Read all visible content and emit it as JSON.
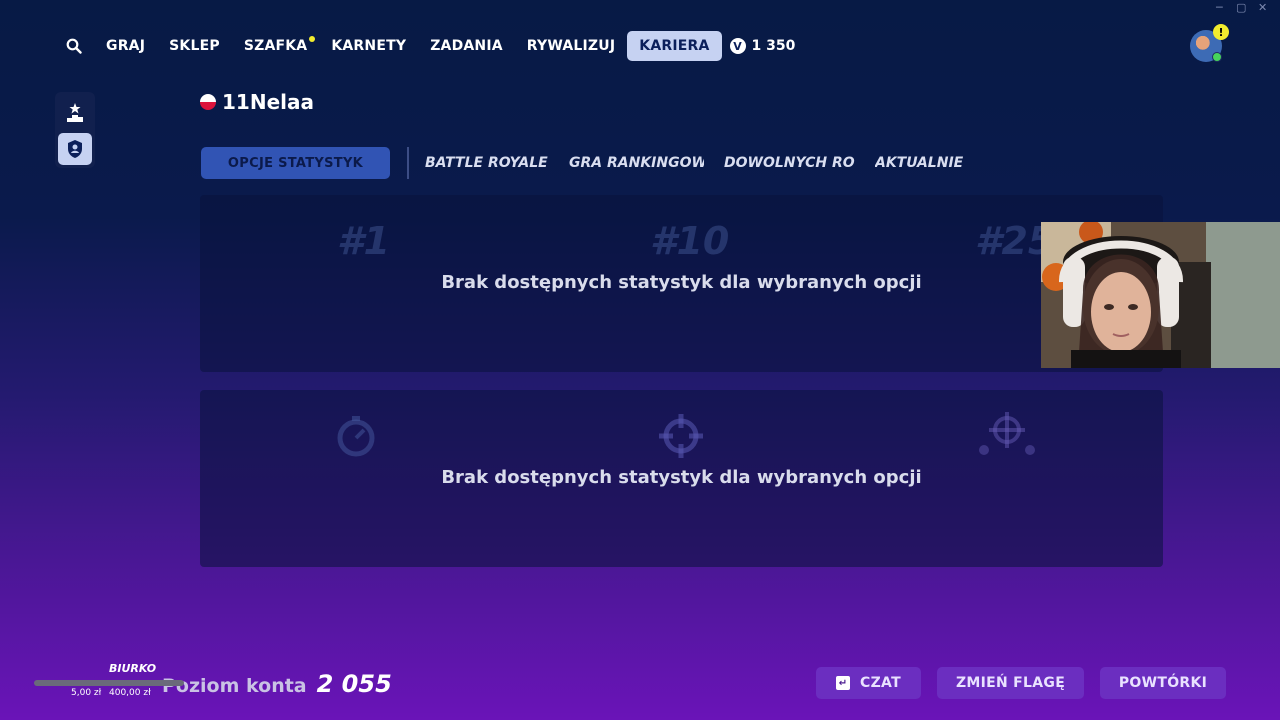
{
  "nav": {
    "items": [
      {
        "label": "GRAJ",
        "active": false,
        "notify": false
      },
      {
        "label": "SKLEP",
        "active": false,
        "notify": false
      },
      {
        "label": "SZAFKA",
        "active": false,
        "notify": true
      },
      {
        "label": "KARNETY",
        "active": false,
        "notify": false
      },
      {
        "label": "ZADANIA",
        "active": false,
        "notify": false
      },
      {
        "label": "RYWALIZUJ",
        "active": false,
        "notify": false
      },
      {
        "label": "KARIERA",
        "active": true,
        "notify": false
      }
    ],
    "vbucks_symbol": "V",
    "vbucks": "1 350"
  },
  "profile": {
    "alert": "!",
    "status_color": "#47d45a"
  },
  "player": {
    "name": "11Nelaa",
    "flag": "Poland"
  },
  "filters": {
    "primary": "OPCJE STATYSTYK",
    "tabs": [
      "BATTLE ROYALE",
      "GRA RANKINGOW",
      "DOWOLNYCH RO:",
      "AKTUALNIE"
    ]
  },
  "panels": [
    {
      "message": "Brak dostępnych statystyk dla wybranych opcji",
      "ghost_labels": [
        "#1",
        "#10",
        "#25"
      ]
    },
    {
      "message": "Brak dostępnych statystyk dla wybranych opcji",
      "ghost_icons": [
        "stopwatch-icon",
        "crosshair-icon",
        "crosshair-group-icon"
      ]
    }
  ],
  "account": {
    "level_label": "Poziom konta",
    "level_value": "2 055"
  },
  "buttons": {
    "chat_key": "↵",
    "chat": "CZAT",
    "change_flag": "ZMIEŃ FLAGĘ",
    "replays": "POWTÓRKI"
  },
  "donation": {
    "title": "BIURKO",
    "min": "5,00 zł",
    "max": "400,00 zł",
    "progress_percent": 0
  },
  "colors": {
    "accent": "#c6d2f2",
    "button": "#6b2ec0",
    "notify_dot": "#f2ec2e"
  }
}
